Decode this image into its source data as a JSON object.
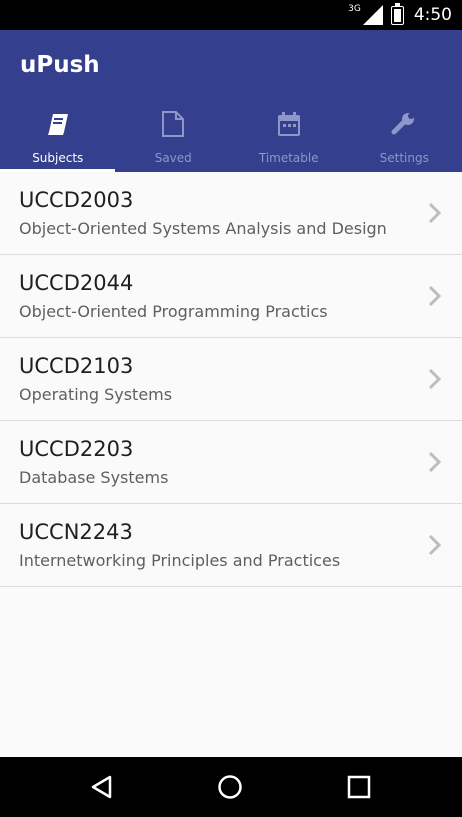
{
  "status_bar": {
    "network": "3G",
    "time": "4:50"
  },
  "app": {
    "title": "uPush"
  },
  "tabs": [
    {
      "label": "Subjects",
      "icon": "book-icon",
      "active": true
    },
    {
      "label": "Saved",
      "icon": "document-icon",
      "active": false
    },
    {
      "label": "Timetable",
      "icon": "calendar-icon",
      "active": false
    },
    {
      "label": "Settings",
      "icon": "wrench-icon",
      "active": false
    }
  ],
  "subjects": [
    {
      "code": "UCCD2003",
      "name": "Object-Oriented Systems Analysis and Design"
    },
    {
      "code": "UCCD2044",
      "name": "Object-Oriented Programming Practics"
    },
    {
      "code": "UCCD2103",
      "name": "Operating Systems"
    },
    {
      "code": "UCCD2203",
      "name": "Database Systems"
    },
    {
      "code": "UCCN2243",
      "name": "Internetworking Principles and Practices"
    }
  ],
  "colors": {
    "primary": "#343f8d",
    "tab_inactive": "#8f96c8",
    "background": "#fafafa",
    "divider": "#dcdcdc",
    "chevron": "#bdbdbd"
  },
  "nav_bar": {
    "buttons": [
      "back-icon",
      "home-icon",
      "recents-icon"
    ]
  }
}
